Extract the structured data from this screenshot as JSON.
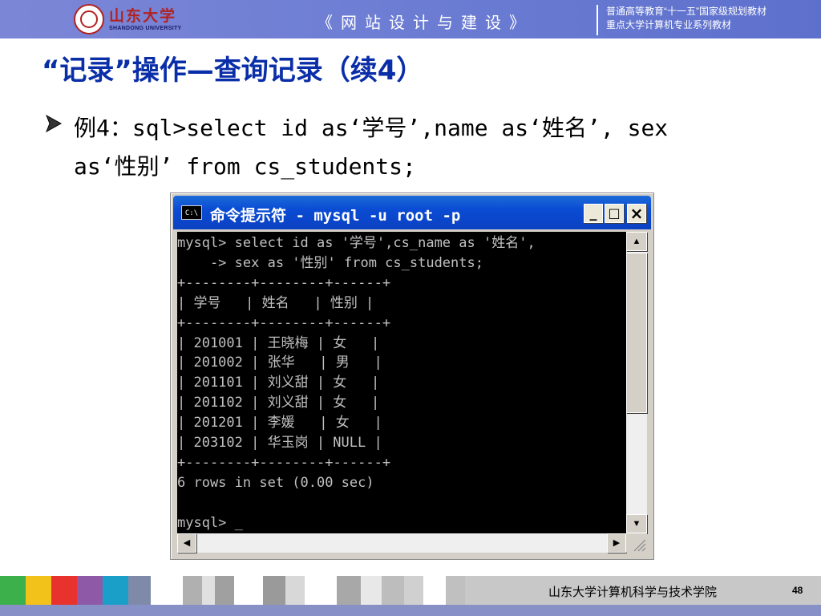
{
  "header": {
    "logo_text": "山东大学",
    "logo_en": "SHANDONG UNIVERSITY",
    "course_title": "《网站设计与建设》",
    "series_line1": "普通高等教育“十一五”国家级规划教材",
    "series_line2": "重点大学计算机专业系列教材"
  },
  "slide": {
    "title": "“记录”操作—查询记录（续4）",
    "bullet": "例4：sql>select id as‘学号’,name as‘姓名’, sex as‘性别’ from cs_students;"
  },
  "console_window": {
    "title": "命令提示符 - mysql -u root -p",
    "icon_label": "C:\\",
    "minimize_label": "_",
    "maximize_label": "□",
    "close_label": "×",
    "lines": [
      "mysql> select id as '学号',cs_name as '姓名',",
      "    -> sex as '性别' from cs_students;",
      "+--------+--------+------+",
      "| 学号   | 姓名   | 性别 |",
      "+--------+--------+------+",
      "| 201001 | 王晓梅 | 女   |",
      "| 201002 | 张华   | 男   |",
      "| 201101 | 刘义甜 | 女   |",
      "| 201102 | 刘义甜 | 女   |",
      "| 201201 | 李媛   | 女   |",
      "| 203102 | 华玉岗 | NULL |",
      "+--------+--------+------+",
      "6 rows in set (0.00 sec)",
      "",
      "mysql> _"
    ]
  },
  "footer": {
    "school": "山东大学计算机科学与技术学院",
    "page_number": "48",
    "strip_colors": [
      "#3cb04a",
      "#f2c21b",
      "#e8322d",
      "#8e5aa8",
      "#1aa0c8",
      "#7f8aa8",
      "#ffffff",
      "#b0b0b0",
      "#e0e0e0",
      "#a0a0a0",
      "#ffffff",
      "#9a9a9a",
      "#d8d8d8",
      "#ffffff",
      "#a8a8a8",
      "#e8e8e8",
      "#bdbdbd",
      "#d0d0d0",
      "#ffffff",
      "#c0c0c0"
    ]
  }
}
